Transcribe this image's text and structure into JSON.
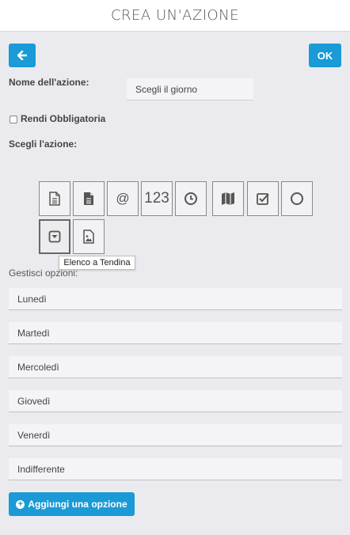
{
  "header": {
    "title": "CREA UN'AZIONE"
  },
  "toolbar": {
    "back_icon": "arrow-left-icon",
    "ok_label": "OK"
  },
  "form": {
    "name_label": "Nome dell'azione:",
    "name_value": "Scegli il giorno",
    "required_label": "Rendi Obbligatoria",
    "required_checked": false,
    "choose_label": "Scegli l'azione:",
    "action_types": [
      {
        "icon": "document-outline-icon"
      },
      {
        "icon": "document-filled-icon"
      },
      {
        "icon": "at-sign-icon",
        "text": "@"
      },
      {
        "icon": "number-icon",
        "text": "123"
      },
      {
        "icon": "clock-icon"
      },
      {
        "icon": "map-icon"
      },
      {
        "icon": "checkbox-icon"
      },
      {
        "icon": "radio-circle-icon"
      },
      {
        "icon": "dropdown-icon",
        "selected": true
      },
      {
        "icon": "image-icon"
      }
    ],
    "tooltip": "Elenco a Tendina",
    "options_label": "Gestisci opzioni:",
    "options": [
      "Lunedì",
      "Martedì",
      "Mercoledì",
      "Giovedì",
      "Venerdì",
      "Indifferente"
    ],
    "add_option_label": "Aggiungi una opzione"
  },
  "colors": {
    "accent": "#1a9ad6",
    "background": "#ebebef"
  }
}
